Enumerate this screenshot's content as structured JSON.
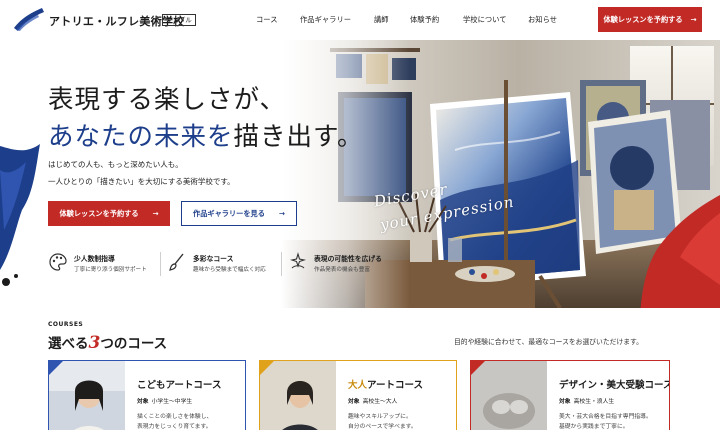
{
  "header": {
    "logo_text": "アトリエ・ルフレ美術学校",
    "logo_tag": "サンプル",
    "nav": [
      "コース",
      "作品ギャラリー",
      "講師",
      "体験予約",
      "学校について",
      "お知らせ"
    ],
    "cta": "体験レッスンを予約する",
    "cta_arrow": "→"
  },
  "hero": {
    "headline_line1": "表現する楽しさが、",
    "headline_line2_a": "あなたの未来を",
    "headline_line2_b": "描き出す。",
    "sub_line1": "はじめての人も、もっと深めたい人も。",
    "sub_line2": "一人ひとりの「描きたい」を大切にする美術学校です。",
    "primary_button": "体験レッスンを予約する",
    "secondary_button": "作品ギャラリーを見る",
    "arrow": "→",
    "script_line1": "Discover",
    "script_line2": "your expression",
    "features": [
      {
        "icon": "palette-icon",
        "title": "少人数制指導",
        "text": "丁寧に寄り添う個別サポート"
      },
      {
        "icon": "brush-icon",
        "title": "多彩なコース",
        "text": "趣味から受験まで幅広く対応"
      },
      {
        "icon": "sparkle-icon",
        "title": "表現の可能性を広げる",
        "text": "作品発表の機会も豊富"
      }
    ]
  },
  "courses": {
    "eyebrow": "COURSES",
    "title_a": "選べる",
    "title_num": "3",
    "title_b": "つのコース",
    "description": "目的や経験に合わせて、最適なコースをお選びいただけます。",
    "cards": [
      {
        "title": "こどもアートコース",
        "target_label": "対象",
        "target": "小学生〜中学生",
        "desc1": "描くことの楽しさを体験し、",
        "desc2": "表現力をじっくり育てます。",
        "accent": "#2f55b0"
      },
      {
        "title_a": "大人",
        "title_b": "アートコース",
        "target_label": "対象",
        "target": "高校生〜大人",
        "desc1": "趣味やスキルアップに。",
        "desc2": "自分のペースで学べます。",
        "accent": "#e0a21a"
      },
      {
        "title": "デザイン・美大受験コース",
        "target_label": "対象",
        "target": "高校生・浪人生",
        "desc1": "美大・芸大合格を目指す専門指導。",
        "desc2": "基礎から実践まで丁寧に。",
        "accent": "#c22a26"
      }
    ]
  }
}
